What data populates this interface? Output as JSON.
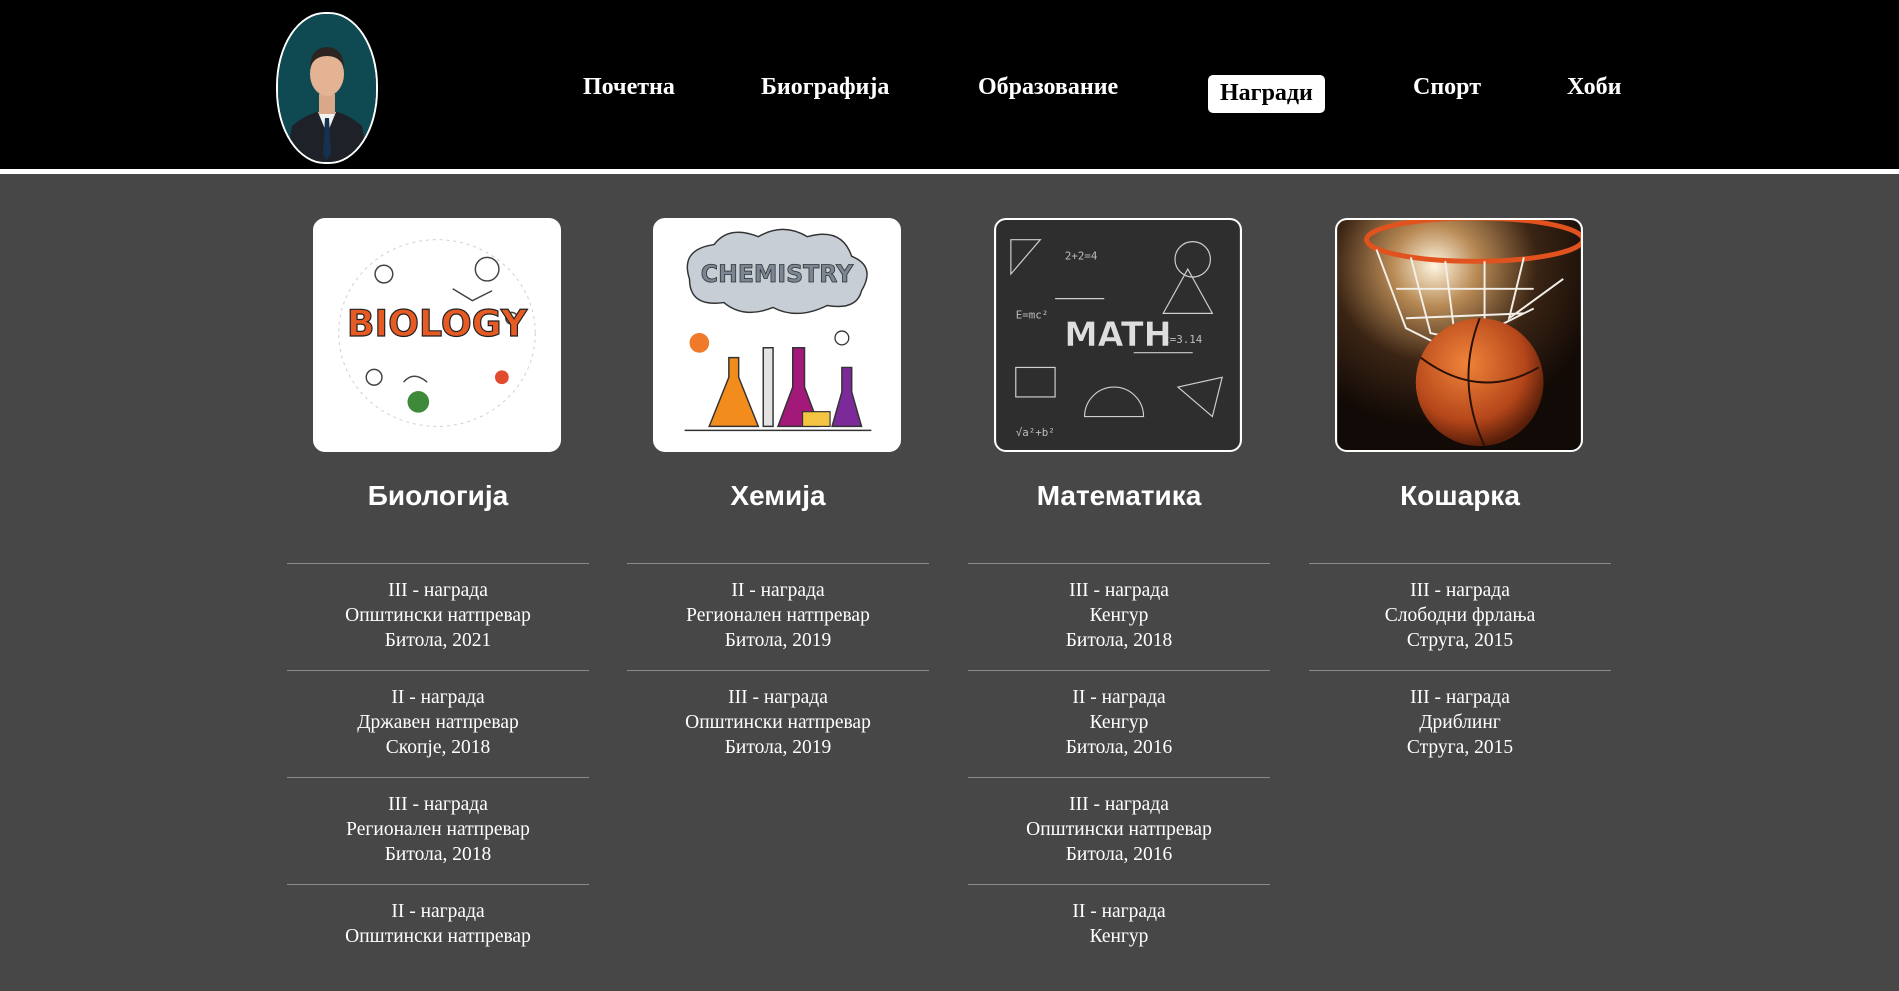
{
  "nav": {
    "items": [
      {
        "label": "Почетна"
      },
      {
        "label": "Биографија"
      },
      {
        "label": "Образование"
      },
      {
        "label": "Награди"
      },
      {
        "label": "Спорт"
      },
      {
        "label": "Хоби"
      }
    ],
    "active": "Награди"
  },
  "columns": [
    {
      "title": "Биологија",
      "image_text": "BIOLOGY",
      "awards": [
        {
          "rank": "III - награда",
          "competition": "Општински натпревар",
          "place": "Битола, 2021"
        },
        {
          "rank": "II - награда",
          "competition": "Државен натпревар",
          "place": "Скопје, 2018"
        },
        {
          "rank": "III - награда",
          "competition": "Регионален натпревар",
          "place": "Битола, 2018"
        },
        {
          "rank": "II - награда",
          "competition": "Општински натпревар",
          "place": ""
        }
      ]
    },
    {
      "title": "Хемија",
      "image_text": "CHEMISTRY",
      "awards": [
        {
          "rank": "II - награда",
          "competition": "Регионален натпревар",
          "place": "Битола, 2019"
        },
        {
          "rank": "III - награда",
          "competition": "Општински натпревар",
          "place": "Битола, 2019"
        }
      ]
    },
    {
      "title": "Математика",
      "image_text": "MATH",
      "awards": [
        {
          "rank": "III - награда",
          "competition": "Кенгур",
          "place": "Битола, 2018"
        },
        {
          "rank": "II - награда",
          "competition": "Кенгур",
          "place": "Битола, 2016"
        },
        {
          "rank": "III - награда",
          "competition": "Општински натпревар",
          "place": "Битола, 2016"
        },
        {
          "rank": "II - награда",
          "competition": "Кенгур",
          "place": ""
        }
      ]
    },
    {
      "title": "Кошарка",
      "image_text": "",
      "awards": [
        {
          "rank": "III - награда",
          "competition": "Слободни фрлања",
          "place": "Струга, 2015"
        },
        {
          "rank": "III - награда",
          "competition": "Дриблинг",
          "place": "Струга, 2015"
        }
      ]
    }
  ],
  "colors": {
    "header_bg": "#000000",
    "page_bg": "#474747",
    "text": "#ffffff",
    "divider": "#8a8a8a"
  }
}
